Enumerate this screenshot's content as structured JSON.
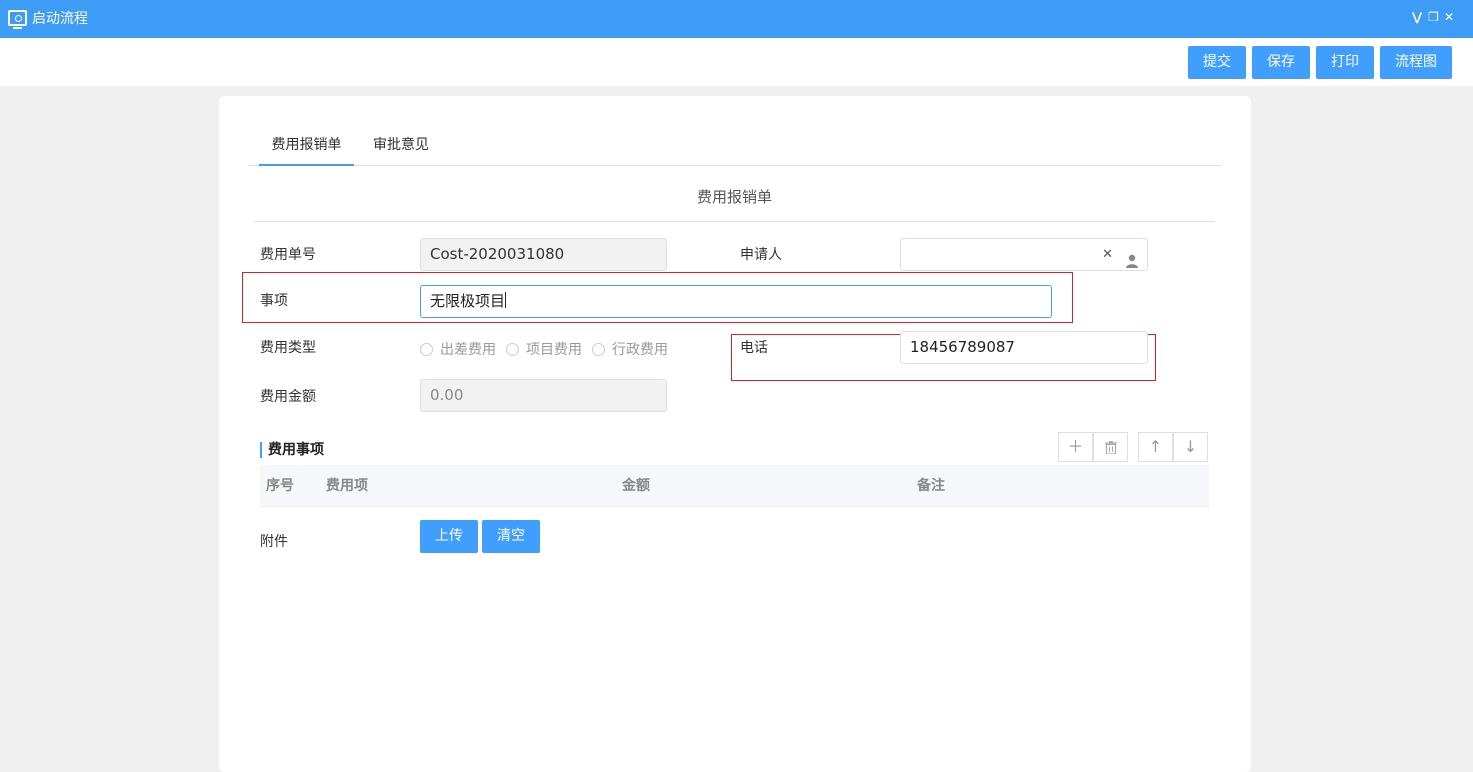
{
  "window": {
    "title": "启动流程",
    "controls": [
      "collapse-icon",
      "restore-icon",
      "close-icon"
    ]
  },
  "toolbar": {
    "submit_label": "提交",
    "save_label": "保存",
    "print_label": "打印",
    "flowchart_label": "流程图"
  },
  "tabs": [
    {
      "label": "费用报销单",
      "active": true
    },
    {
      "label": "审批意见",
      "active": false
    }
  ],
  "form": {
    "title": "费用报销单",
    "expense_no": {
      "label": "费用单号",
      "value": "Cost-2020031080"
    },
    "applicant": {
      "label": "申请人",
      "value": ""
    },
    "matter": {
      "label": "事项",
      "value": "无限极项目"
    },
    "expense_type": {
      "label": "费用类型",
      "options": [
        "出差费用",
        "项目费用",
        "行政费用"
      ]
    },
    "phone": {
      "label": "电话",
      "value": "18456789087"
    },
    "amount": {
      "label": "费用金额",
      "value": "0.00"
    }
  },
  "items_section": {
    "title": "费用事项",
    "columns": [
      "序号",
      "费用项",
      "金额",
      "备注"
    ],
    "rows": []
  },
  "attachment": {
    "label": "附件",
    "upload_label": "上传",
    "clear_label": "清空"
  },
  "colors": {
    "accent": "#409eff",
    "titlebar": "#3d9cf5",
    "highlight": "#e02020"
  }
}
